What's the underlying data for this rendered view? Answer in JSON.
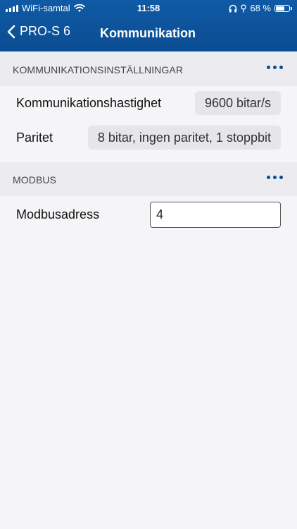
{
  "status_bar": {
    "carrier": "WiFi-samtal",
    "time": "11:58",
    "battery_percent_text": "68 %",
    "battery_level": 0.68,
    "icons": [
      "signal-icon",
      "wifi-icon",
      "headphones-icon",
      "battery-icon"
    ]
  },
  "nav": {
    "back_label": "PRO-S 6",
    "title": "Kommunikation"
  },
  "sections": {
    "communication": {
      "title": "KOMMUNIKATIONSINSTÄLLNINGAR",
      "rows": [
        {
          "label": "Kommunikationshastighet",
          "value": "9600 bitar/s"
        },
        {
          "label": "Paritet",
          "value": "8 bitar, ingen paritet, 1 stoppbit"
        }
      ]
    },
    "modbus": {
      "title": "MODBUS",
      "address_label": "Modbusadress",
      "address_value": "4"
    }
  },
  "colors": {
    "header_blue": "#0b4d92",
    "section_bg": "#ececf0",
    "page_bg": "#f5f5f7",
    "chip_bg": "#e5e5ea"
  }
}
